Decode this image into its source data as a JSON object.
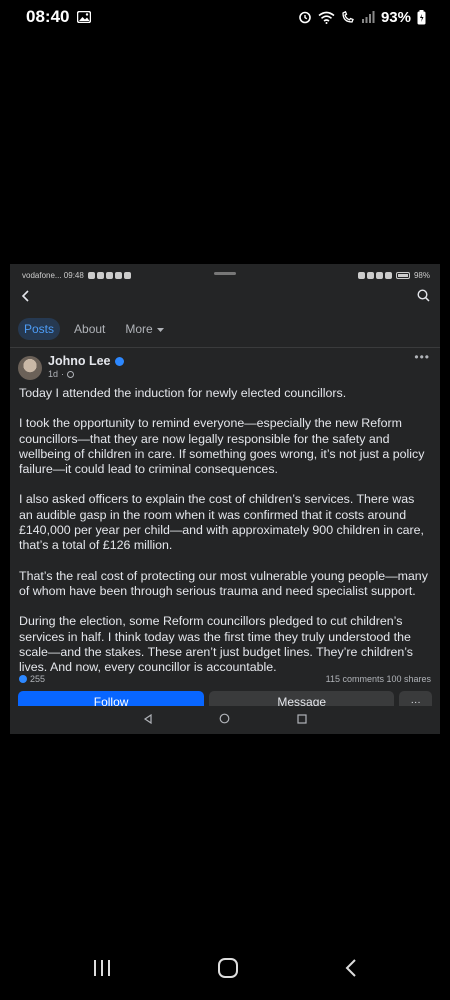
{
  "phone_status": {
    "time": "08:40",
    "battery": "93%"
  },
  "inner_status": {
    "carrier_time": "vodafone... 09:48",
    "battery": "98%"
  },
  "tabs": [
    {
      "label": "Posts",
      "active": true
    },
    {
      "label": "About",
      "active": false
    },
    {
      "label": "More",
      "active": false
    }
  ],
  "post": {
    "author": "Johno Lee",
    "time": "1d",
    "paragraphs": [
      "Today I attended the induction for newly elected councillors.",
      "I took the opportunity to remind everyone—especially the new Reform councillors—that they are now legally responsible for the safety and wellbeing of children in care. If something goes wrong, it’s not just a policy failure—it could lead to criminal consequences.",
      "I also asked officers to explain the cost of children’s services. There was an audible gasp in the room when it was confirmed that it costs around £140,000 per year per child—and with approximately 900 children in care, that’s a total of £126 million.",
      "That’s the real cost of protecting our most vulnerable young people—many of whom have been through serious trauma and need specialist support.",
      "During the election, some Reform councillors pledged to cut children’s services in half. I think today was the first time they truly understood the scale—and the stakes. These aren’t just budget lines. They’re children’s lives. And now, every councillor is accountable."
    ],
    "reactions": "255",
    "comments_shares": "115 comments  100 shares"
  },
  "actions": {
    "follow": "Follow",
    "message": "Message",
    "more": "···"
  },
  "icons": {
    "back": "back-arrow-icon",
    "search": "search-icon",
    "options": "more-options-icon"
  },
  "colors": {
    "accent": "#0866ff",
    "active_tab_bg": "#263951",
    "active_tab_text": "#4e9df7",
    "card_bg": "#242526"
  }
}
